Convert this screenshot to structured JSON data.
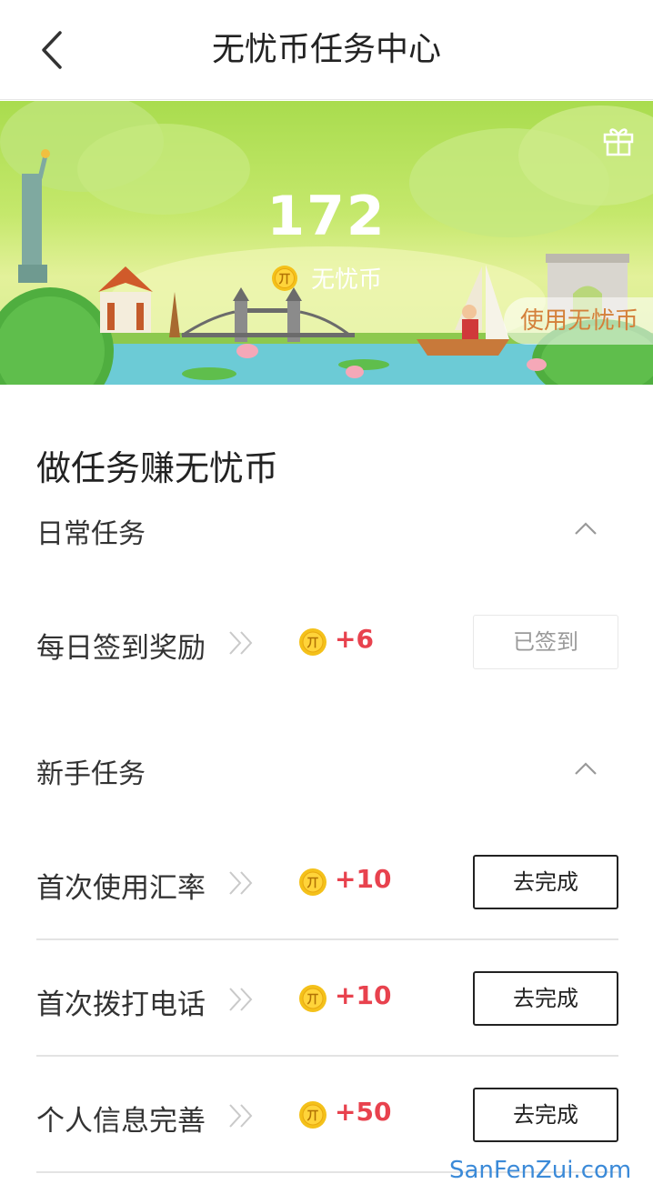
{
  "header": {
    "title": "无忧币任务中心"
  },
  "banner": {
    "coin_count": "172",
    "coin_label": "无忧币",
    "use_button": "使用无忧币",
    "coin_icon_text": "丌"
  },
  "section_title": "做任务赚无忧币",
  "groups": [
    {
      "title": "日常任务",
      "tasks": [
        {
          "name": "每日签到奖励",
          "reward": "+6",
          "button": "已签到",
          "done": true
        }
      ]
    },
    {
      "title": "新手任务",
      "tasks": [
        {
          "name": "首次使用汇率",
          "reward": "+10",
          "button": "去完成",
          "done": false
        },
        {
          "name": "首次拨打电话",
          "reward": "+10",
          "button": "去完成",
          "done": false
        },
        {
          "name": "个人信息完善",
          "reward": "+50",
          "button": "去完成",
          "done": false
        }
      ]
    }
  ],
  "watermark": "SanFenZui.com",
  "colors": {
    "accent_red": "#e8424e",
    "banner_green": "#a9dc4e",
    "coin_gold": "#f4c11a",
    "use_button_text": "#d4803a"
  }
}
